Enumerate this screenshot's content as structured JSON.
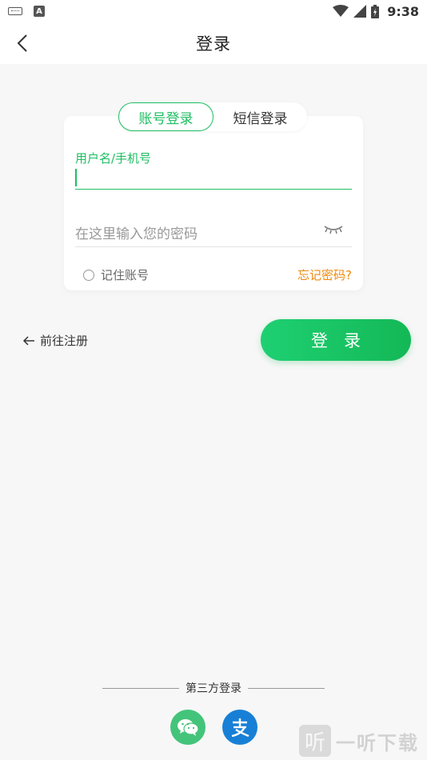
{
  "status_bar": {
    "time": "9:38",
    "icons": [
      "keyboard-icon",
      "a-icon",
      "wifi-icon",
      "signal-icon",
      "battery-icon"
    ]
  },
  "nav": {
    "title": "登录",
    "back_icon": "chevron-left-icon"
  },
  "tabs": [
    {
      "label": "账号登录",
      "active": true
    },
    {
      "label": "短信登录",
      "active": false
    }
  ],
  "form": {
    "username_label": "用户名/手机号",
    "username_value": "",
    "password_placeholder": "在这里输入您的密码",
    "password_toggle_icon": "eye-closed-icon",
    "remember_label": "记住账号",
    "forgot_label": "忘记密码?"
  },
  "actions": {
    "register_label": "前往注册",
    "register_icon": "arrow-left-icon",
    "login_label": "登录"
  },
  "third_party": {
    "label": "第三方登录",
    "providers": [
      {
        "name": "wechat",
        "icon": "wechat-icon",
        "color": "#43c47a"
      },
      {
        "name": "alipay",
        "icon": "alipay-icon",
        "color": "#1780d6"
      }
    ]
  },
  "watermark": {
    "logo_char": "听",
    "text": "一听下载"
  },
  "colors": {
    "accent": "#1dbe62",
    "warning": "#f08a0a",
    "background": "#f7f7f7"
  }
}
